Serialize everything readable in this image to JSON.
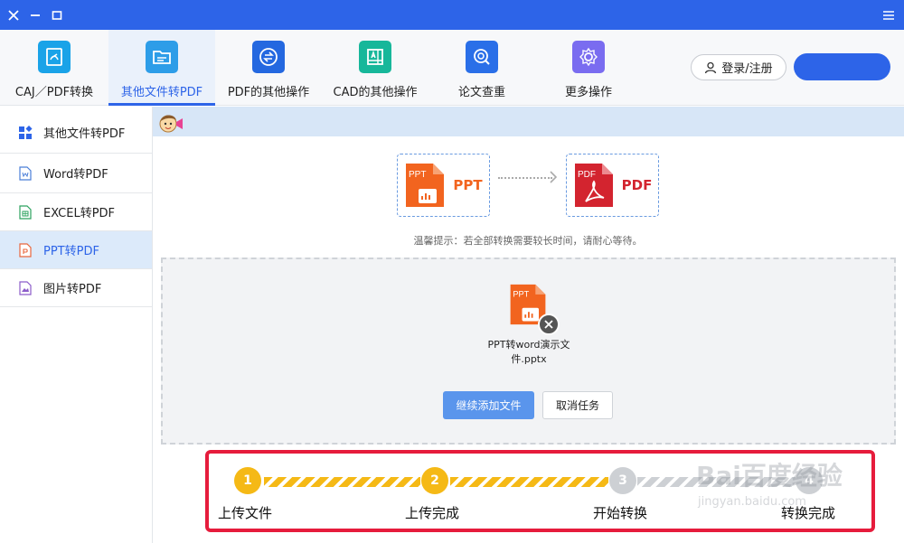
{
  "colors": {
    "accent": "#2d64e8",
    "step_done": "#f5b916",
    "step_todo": "#cdd0d4",
    "highlight_border": "#e61c3c"
  },
  "titlebar": {
    "close_icon": "close-icon",
    "minimize_icon": "minimize-icon",
    "maximize_icon": "maximize-icon",
    "menu_icon": "menu-icon"
  },
  "toolbar": {
    "tabs": [
      {
        "label": "CAJ／PDF转换",
        "icon": "caj-pdf-icon",
        "color": "#1aa3e8"
      },
      {
        "label": "其他文件转PDF",
        "icon": "folder-icon",
        "color": "#2d9de8"
      },
      {
        "label": "PDF的其他操作",
        "icon": "swap-icon",
        "color": "#2468e0"
      },
      {
        "label": "CAD的其他操作",
        "icon": "cad-icon",
        "color": "#17b79a"
      },
      {
        "label": "论文查重",
        "icon": "search-check-icon",
        "color": "#2a6fe8"
      },
      {
        "label": "更多操作",
        "icon": "gear-icon",
        "color": "#7a6cf0"
      }
    ],
    "login_label": "登录/注册",
    "vip_label": ""
  },
  "sidebar": {
    "items": [
      {
        "label": "其他文件转PDF",
        "icon": "grid-icon"
      },
      {
        "label": "Word转PDF",
        "icon": "word-doc-icon"
      },
      {
        "label": "EXCEL转PDF",
        "icon": "excel-doc-icon"
      },
      {
        "label": "PPT转PDF",
        "icon": "ppt-doc-icon"
      },
      {
        "label": "图片转PDF",
        "icon": "image-doc-icon"
      }
    ]
  },
  "conversion": {
    "from_label": "PPT",
    "to_label": "PDF",
    "from_icon_text": "PPT",
    "to_icon_text": "PDF",
    "hint": "温馨提示：若全部转换需要较长时间，请耐心等待。"
  },
  "file": {
    "icon_text": "PPT",
    "name_line1": "PPT转word演示文",
    "name_line2": "件.pptx"
  },
  "buttons": {
    "continue_label": "继续添加文件",
    "cancel_label": "取消任务"
  },
  "steps": [
    {
      "number": "1",
      "label": "上传文件",
      "done": true
    },
    {
      "number": "2",
      "label": "上传完成",
      "done": true
    },
    {
      "number": "3",
      "label": "开始转换",
      "done": false
    },
    {
      "number": "4",
      "label": "转换完成",
      "done": false
    }
  ],
  "watermark": {
    "brand": "Bai百度经验",
    "url": "jingyan.baidu.com"
  }
}
